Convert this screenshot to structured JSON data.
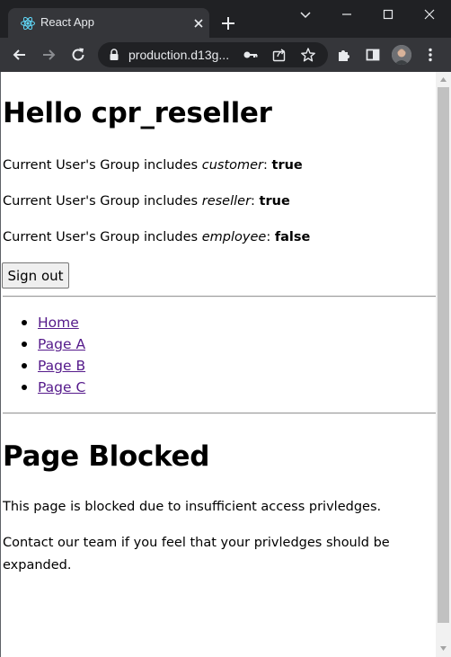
{
  "browser": {
    "tab_title": "React App",
    "url": "production.d13g...",
    "colors": {
      "frame": "#202124",
      "toolbar": "#35363a",
      "text": "#e8eaed"
    }
  },
  "page": {
    "greeting": "Hello cpr_reseller",
    "groups": [
      {
        "prefix": "Current User's Group includes ",
        "group": "customer",
        "sep": ": ",
        "value": "true"
      },
      {
        "prefix": "Current User's Group includes ",
        "group": "reseller",
        "sep": ": ",
        "value": "true"
      },
      {
        "prefix": "Current User's Group includes ",
        "group": "employee",
        "sep": ": ",
        "value": "false"
      }
    ],
    "sign_out_label": "Sign out",
    "nav": [
      {
        "label": "Home"
      },
      {
        "label": "Page A"
      },
      {
        "label": "Page B"
      },
      {
        "label": "Page C"
      }
    ],
    "blocked_title": "Page Blocked",
    "blocked_message": "This page is blocked due to insufficient access privledges.",
    "contact_line1": "Contact our team if you feel that your privledges should be",
    "contact_line2": "expanded.",
    "link_color": "#551a8b"
  }
}
